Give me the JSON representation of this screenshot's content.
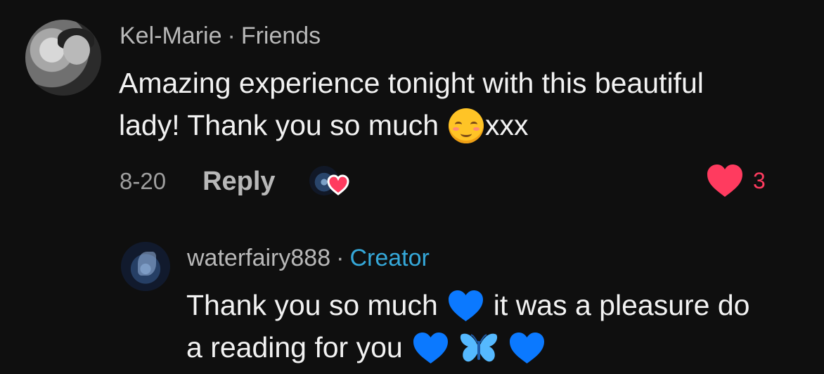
{
  "comment": {
    "author": "Kel-Marie",
    "separator": "·",
    "relationship": "Friends",
    "text_line_1": "Amazing experience tonight with this beautiful",
    "text_line_2_prefix": "lady! Thank you so much",
    "text_line_2_suffix": "xxx",
    "date": "8-20",
    "reply_label": "Reply",
    "like_count": "3",
    "icons": {
      "author_avatar": "profile-photo-avatar",
      "emoji": "smiling-face-icon",
      "creator_liked_avatar": "creator-avatar-icon",
      "creator_liked_heart": "heart-icon",
      "like_heart": "heart-icon"
    },
    "colors": {
      "like": "#ff3b5f"
    }
  },
  "reply": {
    "author": "waterfairy888",
    "separator": "·",
    "role": "Creator",
    "text_line_1_prefix": "Thank you so much",
    "text_line_1_suffix": "it was a pleasure do",
    "text_line_2_prefix": "a reading for you",
    "icons": {
      "author_avatar": "fairy-avatar",
      "emoji_1": "blue-heart-icon",
      "emoji_2": "butterfly-icon",
      "emoji_3": "blue-heart-icon"
    },
    "colors": {
      "creator": "#35a8d9",
      "blue_heart": "#0b79ff"
    }
  }
}
